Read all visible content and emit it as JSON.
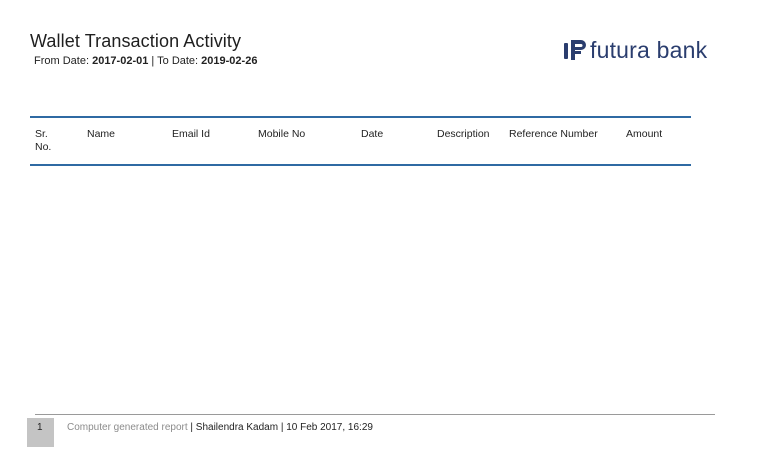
{
  "report": {
    "title": "Wallet Transaction Activity",
    "from_label": "From Date:",
    "from_date": "2017-02-01",
    "separator": "|",
    "to_label": "To Date:",
    "to_date": "2019-02-26"
  },
  "logo": {
    "icon": "futura-bank-logo-icon",
    "text": "futura bank",
    "color": "#2a3d6e"
  },
  "table": {
    "border_color": "#2f6aa3",
    "columns": [
      "Sr. No.",
      "Name",
      "Email Id",
      "Mobile No",
      "Date",
      "Description",
      "Reference Number",
      "Amount"
    ],
    "rows": []
  },
  "footer": {
    "page_number": "1",
    "generated_note": "Computer generated report",
    "author_and_time": "| Shailendra Kadam | 10 Feb 2017, 16:29"
  }
}
